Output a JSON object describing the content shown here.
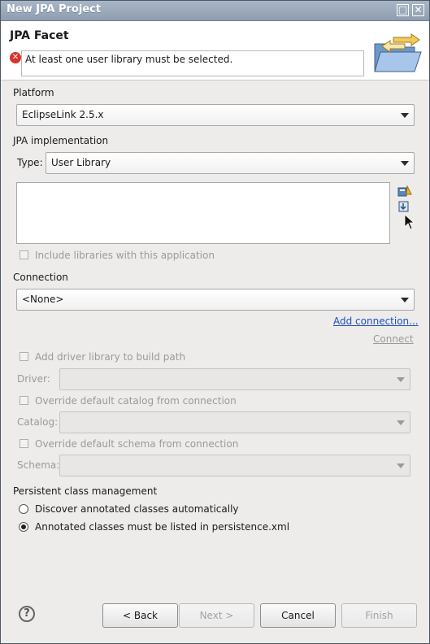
{
  "window": {
    "title": "New JPA Project"
  },
  "header": {
    "heading": "JPA Facet",
    "message": "At least one user library must be selected."
  },
  "platform": {
    "label": "Platform",
    "value": "EclipseLink 2.5.x"
  },
  "jpa_impl": {
    "label": "JPA implementation",
    "type_label": "Type:",
    "type_value": "User Library",
    "include_libraries": "Include libraries with this application"
  },
  "connection": {
    "label": "Connection",
    "value": "<None>",
    "add_connection": "Add connection...",
    "connect": "Connect",
    "add_driver": "Add driver library to build path",
    "driver_label": "Driver:",
    "override_catalog": "Override default catalog from connection",
    "catalog_label": "Catalog:",
    "override_schema": "Override default schema from connection",
    "schema_label": "Schema:"
  },
  "persistent": {
    "label": "Persistent class management",
    "option1": "Discover annotated classes automatically",
    "option2": "Annotated classes must be listed in persistence.xml",
    "selected": 2
  },
  "buttons": {
    "back": "< Back",
    "next": "Next >",
    "cancel": "Cancel",
    "finish": "Finish"
  },
  "icons": {
    "error": "error-icon",
    "wizard": "folder-arrows-icon",
    "help": "help-icon",
    "manage_libraries": "manage-libraries-icon",
    "download_library": "download-library-icon"
  },
  "colors": {
    "error": "#d8342c",
    "link": "#1f4fbf",
    "titlebar": "#9aa9bc"
  }
}
